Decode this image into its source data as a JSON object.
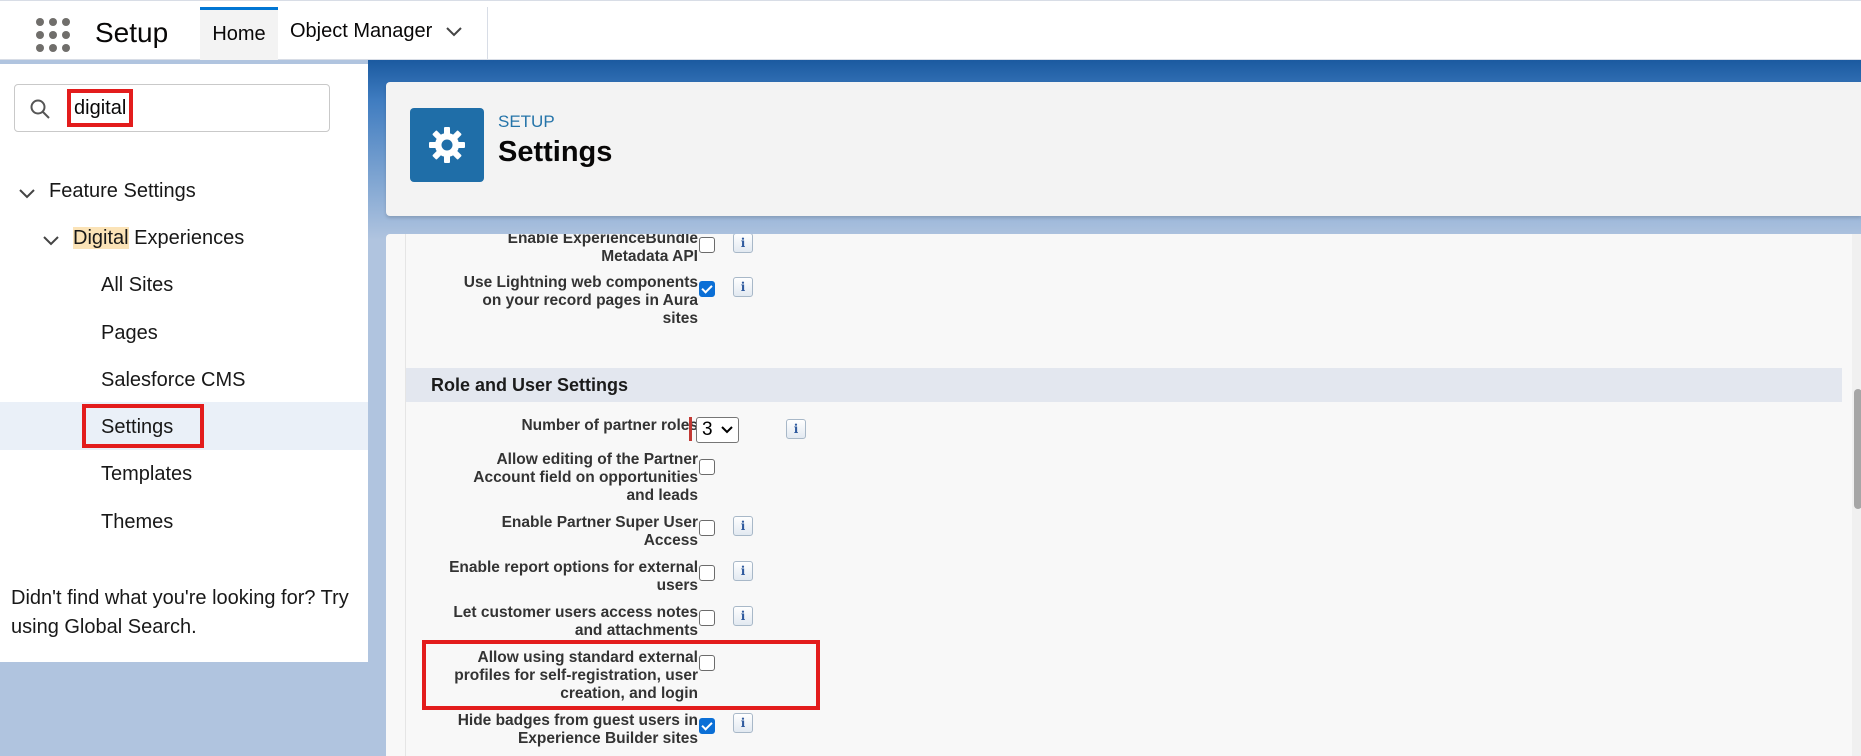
{
  "topbar": {
    "app_title": "Setup",
    "tabs": [
      {
        "label": "Home"
      },
      {
        "label": "Object Manager"
      }
    ]
  },
  "sidebar": {
    "search_value": "digital",
    "tree": {
      "feature_settings": "Feature Settings",
      "digital_highlight": "Digital",
      "digital_rest": " Experiences",
      "items": [
        {
          "label": "All Sites"
        },
        {
          "label": "Pages"
        },
        {
          "label": "Salesforce CMS"
        },
        {
          "label": "Settings"
        },
        {
          "label": "Templates"
        },
        {
          "label": "Themes"
        }
      ]
    },
    "help_text": "Didn't find what you're looking for? Try using Global Search."
  },
  "header": {
    "kicker": "SETUP",
    "title": "Settings"
  },
  "content": {
    "rows_top": [
      {
        "label": "Enable ExperienceBundle Metadata API",
        "checked": false,
        "info": true
      },
      {
        "label": "Use Lightning web components on your record pages in Aura sites",
        "checked": true,
        "info": true
      }
    ],
    "section_title": "Role and User Settings",
    "partner_roles": {
      "label": "Number of partner roles",
      "value": "3"
    },
    "rows": [
      {
        "label": "Allow editing of the Partner Account field on opportunities and leads",
        "checked": false,
        "info": false
      },
      {
        "label": "Enable Partner Super User Access",
        "checked": false,
        "info": true
      },
      {
        "label": "Enable report options for external users",
        "checked": false,
        "info": true
      },
      {
        "label": "Let customer users access notes and attachments",
        "checked": false,
        "info": true
      },
      {
        "label": "Allow using standard external profiles for self-registration, user creation, and login",
        "checked": false,
        "info": false
      },
      {
        "label": "Hide badges from guest users in Experience Builder sites",
        "checked": true,
        "info": true
      }
    ],
    "info_glyph": "i"
  },
  "colors": {
    "brand_blue": "#0176d3",
    "highlight_red": "#e31c1c",
    "header_icon_bg": "#1f6ea8",
    "checkbox_checked": "#0b6fd6"
  }
}
